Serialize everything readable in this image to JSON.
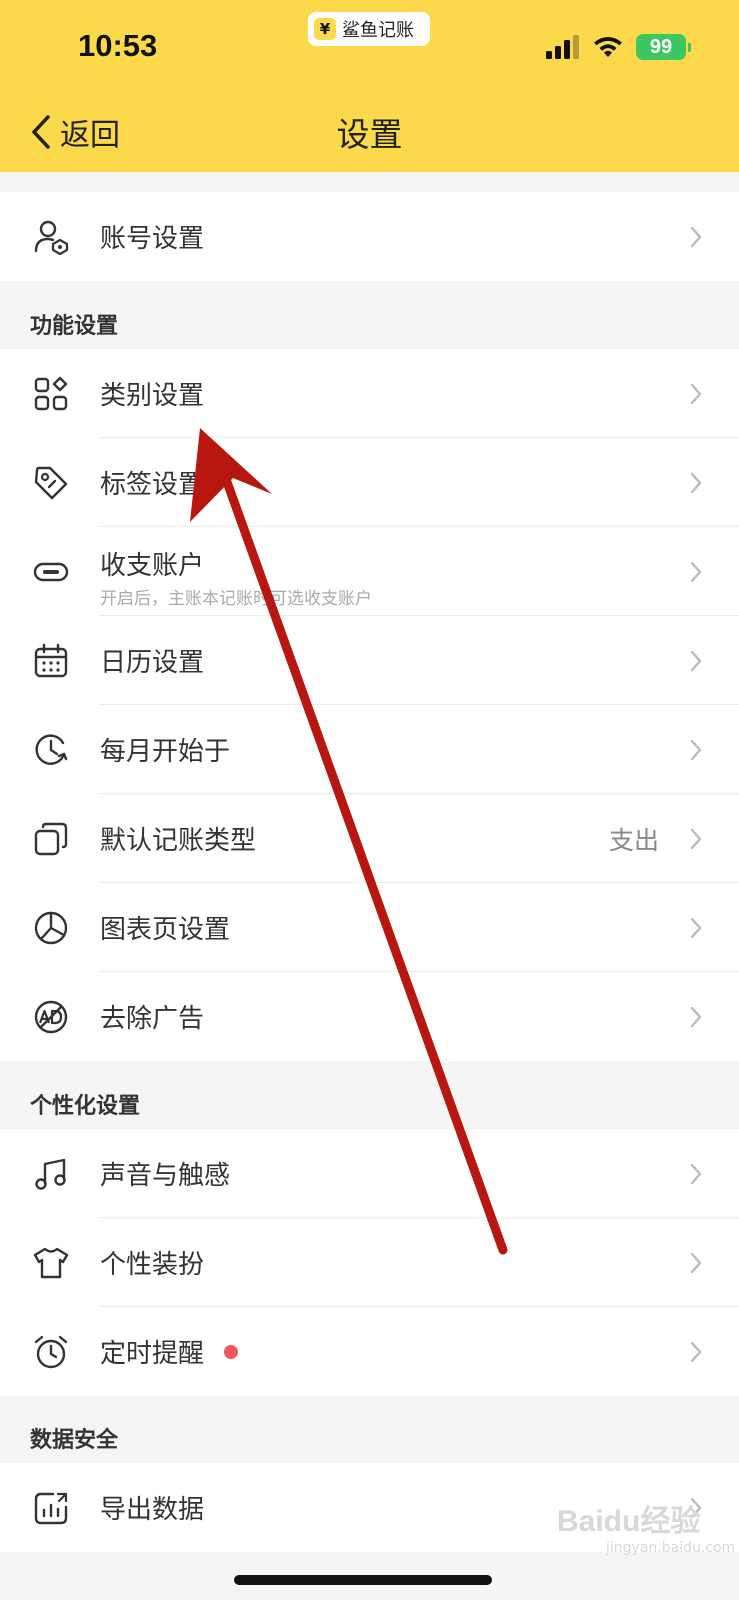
{
  "status_bar": {
    "time": "10:53",
    "app_name": "鲨鱼记账",
    "app_logo_glyph": "¥",
    "battery": "99"
  },
  "nav": {
    "back_label": "返回",
    "title": "设置"
  },
  "account_group": {
    "items": [
      {
        "label": "账号设置",
        "icon": "user-shield-icon"
      }
    ]
  },
  "sections": [
    {
      "title": "功能设置",
      "items": [
        {
          "label": "类别设置",
          "icon": "category-grid-icon"
        },
        {
          "label": "标签设置",
          "icon": "tag-icon"
        },
        {
          "label": "收支账户",
          "sub": "开启后，主账本记账时可选收支账户",
          "icon": "link-icon"
        },
        {
          "label": "日历设置",
          "icon": "calendar-icon"
        },
        {
          "label": "每月开始于",
          "icon": "clock-refresh-icon"
        },
        {
          "label": "默认记账类型",
          "value": "支出",
          "icon": "cards-icon"
        },
        {
          "label": "图表页设置",
          "icon": "pie-chart-icon"
        },
        {
          "label": "去除广告",
          "icon": "no-ads-icon"
        }
      ]
    },
    {
      "title": "个性化设置",
      "items": [
        {
          "label": "声音与触感",
          "icon": "music-note-icon"
        },
        {
          "label": "个性装扮",
          "icon": "tshirt-icon"
        },
        {
          "label": "定时提醒",
          "icon": "alarm-clock-icon",
          "badge": true
        }
      ]
    },
    {
      "title": "数据安全",
      "items": [
        {
          "label": "导出数据",
          "icon": "export-chart-icon"
        }
      ]
    }
  ],
  "watermark": {
    "text": "Baidu经验",
    "sub": "jingyan.baidu.com"
  },
  "colors": {
    "header": "#fcd94a",
    "background": "#f5f5f5",
    "badge": "#f0565c",
    "annotation_arrow": "#b8170f"
  }
}
